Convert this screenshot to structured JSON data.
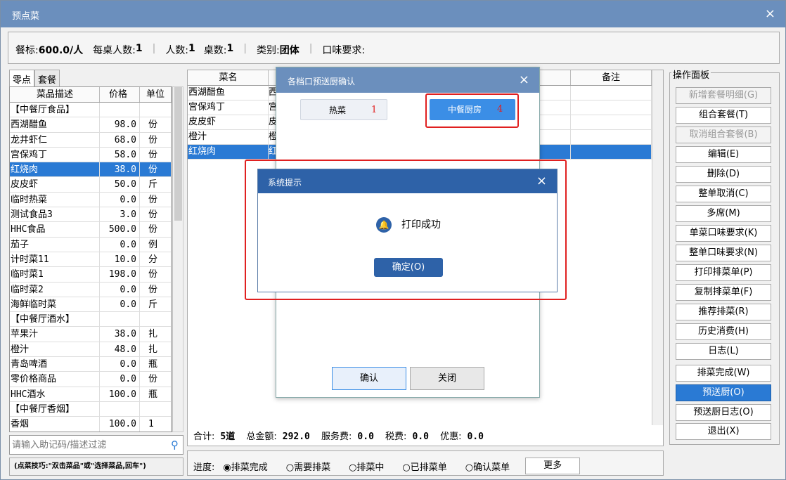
{
  "window": {
    "title": "预点菜",
    "close": "×"
  },
  "info": {
    "meal_std_label": "餐标:",
    "meal_std_value": "600.0/人",
    "per_table_label": "每桌人数:",
    "per_table_value": "1",
    "people_label": "人数:",
    "people_value": "1",
    "tables_label": "桌数:",
    "tables_value": "1",
    "category_label": "类别:",
    "category_value": "团体",
    "taste_label": "口味要求:"
  },
  "left": {
    "tabs": [
      "零点",
      "套餐"
    ],
    "headers": [
      "菜品描述",
      "价格",
      "单位"
    ],
    "rows": [
      [
        "【中餐厅食品】",
        "",
        ""
      ],
      [
        "西湖醋鱼",
        "98.0",
        "份"
      ],
      [
        "龙井虾仁",
        "68.0",
        "份"
      ],
      [
        "宫保鸡丁",
        "58.0",
        "份"
      ],
      [
        "红烧肉",
        "38.0",
        "份"
      ],
      [
        "皮皮虾",
        "50.0",
        "斤"
      ],
      [
        "临时热菜",
        "0.0",
        "份"
      ],
      [
        "测试食品3",
        "3.0",
        "份"
      ],
      [
        "HHC食品",
        "500.0",
        "份"
      ],
      [
        "茄子",
        "0.0",
        "例"
      ],
      [
        "计时菜11",
        "10.0",
        "分"
      ],
      [
        "临时菜1",
        "198.0",
        "份"
      ],
      [
        "临时菜2",
        "0.0",
        "份"
      ],
      [
        "海鲜临时菜",
        "0.0",
        "斤"
      ],
      [
        "【中餐厅酒水】",
        "",
        ""
      ],
      [
        "苹果汁",
        "38.0",
        "扎"
      ],
      [
        "橙汁",
        "48.0",
        "扎"
      ],
      [
        "青岛啤酒",
        "0.0",
        "瓶"
      ],
      [
        "零价格商品",
        "0.0",
        "份"
      ],
      [
        "HHC酒水",
        "100.0",
        "瓶"
      ],
      [
        "【中餐厅香烟】",
        "",
        ""
      ],
      [
        "香烟",
        "100.0",
        "1"
      ]
    ],
    "selected_index": 4,
    "filter_placeholder": "请输入助记码/描述过滤",
    "tip": "(点菜技巧:\"双击菜品\"或\"选择菜品,回车\")"
  },
  "center": {
    "headers": [
      "菜名",
      "",
      "备注"
    ],
    "rows": [
      [
        "西湖醋鱼",
        "西",
        ""
      ],
      [
        "宫保鸡丁",
        "宫",
        ""
      ],
      [
        "皮皮虾",
        "皮",
        ""
      ],
      [
        "橙汁",
        "橙",
        ""
      ],
      [
        "红烧肉",
        "红",
        ""
      ]
    ],
    "selected_index": 4,
    "totals": {
      "total_label": "合计:",
      "total_value": "5道",
      "amount_label": "总金额:",
      "amount_value": "292.0",
      "service_label": "服务费:",
      "service_value": "0.0",
      "tax_label": "税费:",
      "tax_value": "0.0",
      "discount_label": "优惠:",
      "discount_value": "0.0"
    }
  },
  "progress": {
    "label": "进度:",
    "options": [
      "◉排菜完成",
      "○需要排菜",
      "○排菜中",
      "○已排菜单",
      "○确认菜单"
    ],
    "more": "更多"
  },
  "ops": {
    "title": "操作面板",
    "buttons": [
      "新增套餐明细(G)",
      "组合套餐(T)",
      "取消组合套餐(B)",
      "编辑(E)",
      "删除(D)",
      "整单取消(C)",
      "多席(M)",
      "单菜口味要求(K)",
      "整单口味要求(N)",
      "打印排菜单(P)",
      "复制排菜单(F)",
      "推荐排菜(R)",
      "历史消费(H)",
      "日志(L)",
      "排菜完成(W)",
      "预送厨(O)",
      "预送厨日志(O)",
      "退出(X)"
    ]
  },
  "kitchen_dialog": {
    "title": "各档口预送厨确认",
    "close": "×",
    "stations": [
      {
        "name": "热菜",
        "count": "1"
      },
      {
        "name": "中餐厨房",
        "count": "4"
      }
    ],
    "confirm": "确认",
    "close_btn": "关闭"
  },
  "alert": {
    "title": "系统提示",
    "close": "×",
    "message": "打印成功",
    "ok": "确定(O)",
    "accent": "#2e62a8"
  }
}
